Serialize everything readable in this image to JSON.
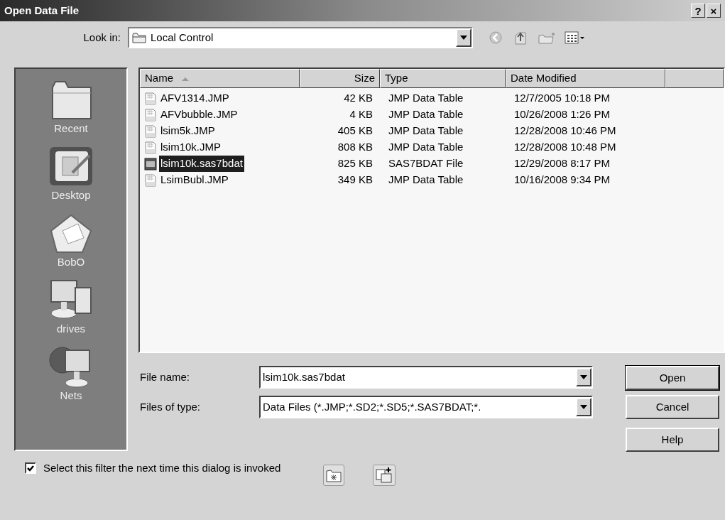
{
  "window": {
    "title": "Open Data File",
    "title_buttons": [
      "?",
      "×"
    ]
  },
  "look_in": {
    "label": "Look in:",
    "value": "Local Control"
  },
  "places": [
    {
      "label": "Recent",
      "kind": "recent"
    },
    {
      "label": "Desktop",
      "kind": "desktop"
    },
    {
      "label": "BobO",
      "kind": "documents"
    },
    {
      "label": "drives",
      "kind": "computer"
    },
    {
      "label": "Nets",
      "kind": "network"
    }
  ],
  "file_list": {
    "columns": [
      {
        "label": "Name",
        "sorted": true
      },
      {
        "label": "Size",
        "sorted": false
      },
      {
        "label": "Type",
        "sorted": false
      },
      {
        "label": "Date Modified",
        "sorted": false
      }
    ],
    "rows": [
      {
        "name": "AFV1314.JMP",
        "size": "42 KB",
        "type": "JMP Data Table",
        "date": "12/7/2005 10:18 PM",
        "kind": "jmp",
        "selected": false
      },
      {
        "name": "AFVbubble.JMP",
        "size": "4 KB",
        "type": "JMP Data Table",
        "date": "10/26/2008 1:26 PM",
        "kind": "jmp",
        "selected": false
      },
      {
        "name": "lsim5k.JMP",
        "size": "405 KB",
        "type": "JMP Data Table",
        "date": "12/28/2008 10:46 PM",
        "kind": "jmp",
        "selected": false
      },
      {
        "name": "lsim10k.JMP",
        "size": "808 KB",
        "type": "JMP Data Table",
        "date": "12/28/2008 10:48 PM",
        "kind": "jmp",
        "selected": false
      },
      {
        "name": "lsim10k.sas7bdat",
        "size": "825 KB",
        "type": "SAS7BDAT File",
        "date": "12/29/2008 8:17 PM",
        "kind": "sas",
        "selected": true
      },
      {
        "name": "LsimBubl.JMP",
        "size": "349 KB",
        "type": "JMP Data Table",
        "date": "10/16/2008 9:34 PM",
        "kind": "jmp",
        "selected": false
      }
    ]
  },
  "file_name": {
    "label": "File name:",
    "value": "lsim10k.sas7bdat"
  },
  "files_of_type": {
    "label": "Files of type:",
    "value": "Data Files (*.JMP;*.SD2;*.SD5;*.SAS7BDAT;*."
  },
  "buttons": [
    "Open",
    "Cancel",
    "Help"
  ],
  "filter_checkbox": {
    "label": "Select this filter the next time this dialog is invoked",
    "checked": true
  }
}
